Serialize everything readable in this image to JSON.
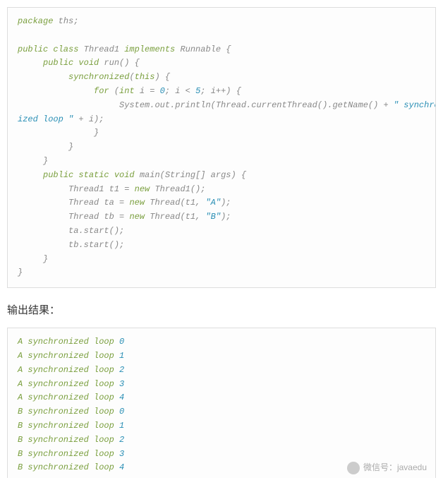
{
  "code": {
    "l1": "package",
    "l1b": " ths;",
    "l2a": "public class",
    "l2b": " Thread1 ",
    "l2c": "implements",
    "l2d": " Runnable {",
    "l3a": "public void",
    "l3b": " run",
    "l3c": "() {",
    "l4a": "synchronized",
    "l4b": "(",
    "l4c": "this",
    "l4d": ") {",
    "l5a": "for",
    "l5b": " (",
    "l5c": "int",
    "l5d": " i = ",
    "l5e": "0",
    "l5f": "; i < ",
    "l5g": "5",
    "l5h": "; i++) {",
    "l6a": "System.out.println(Thread.currentThread().getName() + ",
    "l6b": "\" synchron",
    "l7a": "ized loop \"",
    "l7b": " + i);",
    "l8": "}",
    "l9": "}",
    "l10": "}",
    "l11a": "public static void",
    "l11b": " main",
    "l11c": "(String[] args) {",
    "l12a": "Thread1 t1 = ",
    "l12b": "new",
    "l12c": " Thread1();",
    "l13a": "Thread ta = ",
    "l13b": "new",
    "l13c": " Thread(t1, ",
    "l13d": "\"A\"",
    "l13e": ");",
    "l14a": "Thread tb = ",
    "l14b": "new",
    "l14c": " Thread(t1, ",
    "l14d": "\"B\"",
    "l14e": ");",
    "l15": "ta.start();",
    "l16": "tb.start();",
    "l17": "}",
    "l18": "}"
  },
  "section_title": "输出结果：",
  "output": [
    {
      "t": "A synchronized loop ",
      "n": "0"
    },
    {
      "t": "A synchronized loop ",
      "n": "1"
    },
    {
      "t": "A synchronized loop ",
      "n": "2"
    },
    {
      "t": "A synchronized loop ",
      "n": "3"
    },
    {
      "t": "A synchronized loop ",
      "n": "4"
    },
    {
      "t": "B synchronized loop ",
      "n": "0"
    },
    {
      "t": "B synchronized loop ",
      "n": "1"
    },
    {
      "t": "B synchronized loop ",
      "n": "2"
    },
    {
      "t": "B synchronized loop ",
      "n": "3"
    },
    {
      "t": "B synchronized loop ",
      "n": "4"
    }
  ],
  "watermark": "微信号：javaedu"
}
